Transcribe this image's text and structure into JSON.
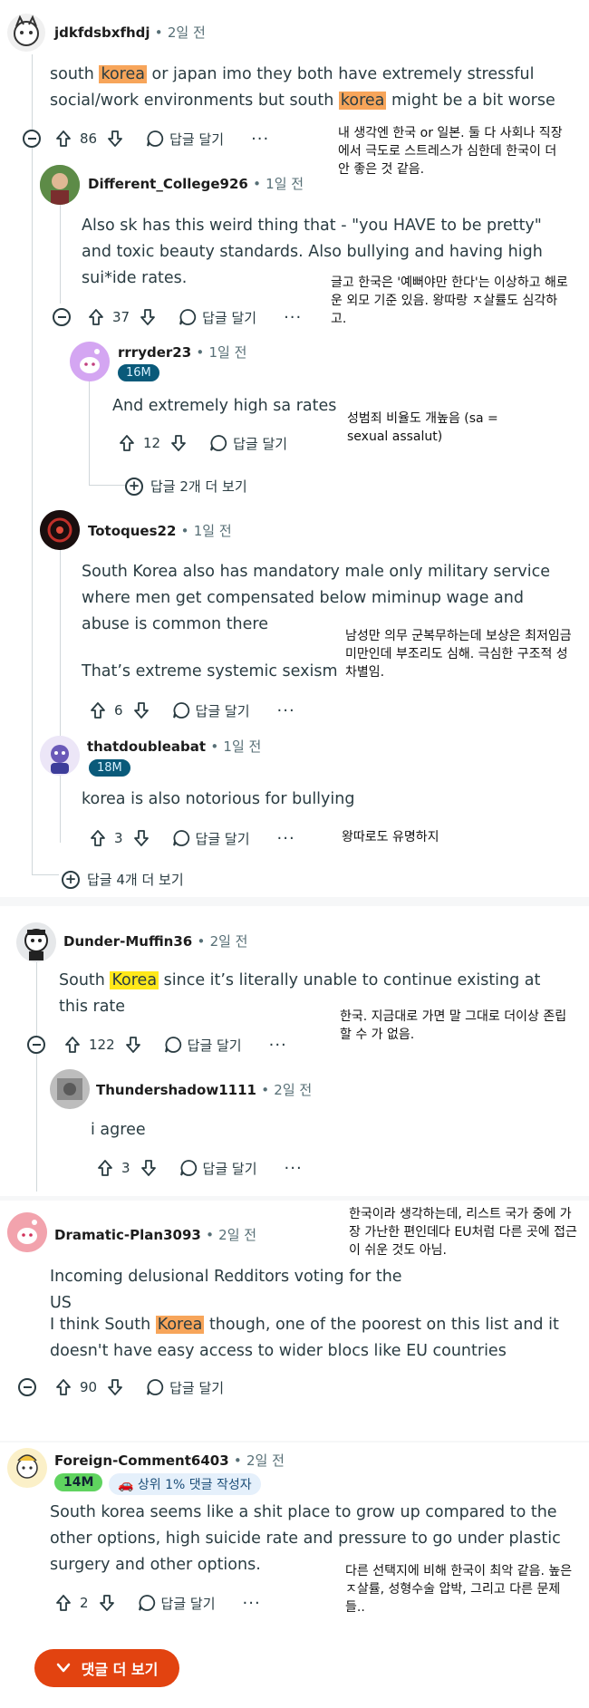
{
  "comments": {
    "c1": {
      "user": "jdkfdsbxfhdj",
      "age": "2일 전",
      "text_a": "south ",
      "hl1": "korea",
      "text_b": " or japan imo they both have extremely stressful social/work environments but south ",
      "hl2": "korea",
      "text_c": " might be a bit worse",
      "votes": "86",
      "reply": "답글 달기",
      "note": "내 생각엔 한국 or 일본. 둘 다 사회나 직장에서 극도로 스트레스가 심한데 한국이 더 안 좋은 것 같음."
    },
    "c2": {
      "user": "Different_College926",
      "age": "1일 전",
      "text": "Also sk has this weird thing that - \"you HAVE to be pretty\" and toxic beauty standards. Also bullying and having high sui*ide rates.",
      "votes": "37",
      "reply": "답글 달기",
      "note": "글고 한국은 '예뻐야만 한다'는 이상하고 해로운 외모 기준 있음. 왕따랑 ㅈ살률도 심각하고."
    },
    "c3": {
      "user": "rrryder23",
      "age": "1일 전",
      "badge": "16M",
      "text": "And extremely high sa rates",
      "votes": "12",
      "reply": "답글 달기",
      "note": "성범죄 비율도 개높음 (sa = sexual assalut)",
      "expand": "답글 2개 더 보기"
    },
    "c4": {
      "user": "Totoques22",
      "age": "1일 전",
      "text1": "South Korea also has mandatory male only military service where men get compensated below miminup wage and abuse is common there",
      "text2": "That’s extreme systemic sexism",
      "votes": "6",
      "reply": "답글 달기",
      "note": "남성만 의무 군복무하는데 보상은 최저임금 미만인데 부조리도 심해. 극심한 구조적 성차별임."
    },
    "c5": {
      "user": "thatdoubleabat",
      "age": "1일 전",
      "badge": "18M",
      "text": "korea is also notorious for bullying",
      "votes": "3",
      "reply": "답글 달기",
      "note": "왕따로도 유명하지",
      "expand": "답글 4개 더 보기"
    },
    "c6": {
      "user": "Dunder-Muffin36",
      "age": "2일 전",
      "text_a": "South ",
      "hl": "Korea",
      "text_b": " since it’s literally unable to continue existing at this rate",
      "votes": "122",
      "reply": "답글 달기",
      "note": "한국. 지금대로 가면 말 그대로 더이상 존립할 수 가 없음."
    },
    "c7": {
      "user": "Thundershadow1111",
      "age": "2일 전",
      "text": "i agree",
      "votes": "3",
      "reply": "답글 달기"
    },
    "c8": {
      "user": "Dramatic-Plan3093",
      "age": "2일 전",
      "text1": "Incoming delusional Redditors voting for the US",
      "text2_a": "I think South ",
      "hl": "Korea",
      "text2_b": " though, one of the poorest on this list and it doesn't have easy access to wider blocs like EU countries",
      "votes": "90",
      "reply": "답글 달기",
      "note": "한국이라 생각하는데, 리스트 국가 중에 가장 가난한 편인데다 EU처럼 다른 곳에 접근이 쉬운 것도 아님."
    },
    "c9": {
      "user": "Foreign-Comment6403",
      "age": "2일 전",
      "badge": "14M",
      "badge2": "상위 1% 댓글 작성자",
      "text": "South korea seems like a shit place to grow up compared to the other options, high suicide rate and pressure to go under plastic surgery and other options.",
      "votes": "2",
      "reply": "답글 달기",
      "note": "다른 선택지에 비해 한국이 최악 같음. 높은 ㅈ살률, 성형수술 압박, 그리고 다른 문제들.."
    }
  },
  "sep": "•",
  "more_dots": "···",
  "more_comments": "댓글 더 보기",
  "colors": {
    "highlight_orange": "#f7a55a",
    "highlight_yellow": "#ffe81a",
    "accent": "#e24310"
  }
}
